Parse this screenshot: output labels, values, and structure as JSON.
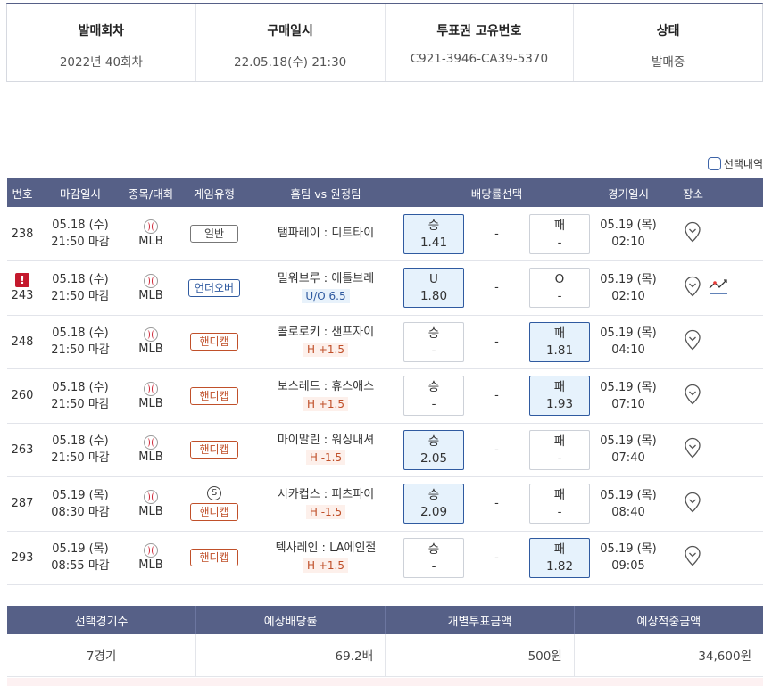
{
  "summary": {
    "round_label": "발매회차",
    "round_value": "2022년 40회차",
    "purchase_label": "구매일시",
    "purchase_value": "22.05.18(수) 21:30",
    "ticket_label": "투표권 고유번호",
    "ticket_value": "C921-3946-CA39-5370",
    "status_label": "상태",
    "status_value": "발매중"
  },
  "selection_history": "선택내역",
  "columns": [
    "번호",
    "마감일시",
    "종목/대회",
    "게임유형",
    "홈팀 vs 원정팀",
    "배당률선택",
    "경기일시",
    "장소"
  ],
  "rows": [
    {
      "no": "238",
      "dl_date": "05.18 (수)",
      "dl_time": "21:50 마감",
      "league": "MLB",
      "type": "일반",
      "type_kind": "normal",
      "s_badge": "",
      "home": "탬파레이",
      "away": "디트타이",
      "sub": "",
      "sub_kind": "",
      "left_label": "승",
      "left_odd": "1.41",
      "left_sel": true,
      "mid": "-",
      "right_label": "패",
      "right_odd": "-",
      "right_sel": false,
      "g_date": "05.19 (목)",
      "g_time": "02:10",
      "warn": false,
      "trend": false
    },
    {
      "no": "243",
      "dl_date": "05.18 (수)",
      "dl_time": "21:50 마감",
      "league": "MLB",
      "type": "언더오버",
      "type_kind": "uo",
      "s_badge": "",
      "home": "밀워브루",
      "away": "애틀브레",
      "sub": "U/O 6.5",
      "sub_kind": "uo",
      "left_label": "U",
      "left_odd": "1.80",
      "left_sel": true,
      "mid": "-",
      "right_label": "O",
      "right_odd": "-",
      "right_sel": false,
      "g_date": "05.19 (목)",
      "g_time": "02:10",
      "warn": true,
      "trend": true
    },
    {
      "no": "248",
      "dl_date": "05.18 (수)",
      "dl_time": "21:50 마감",
      "league": "MLB",
      "type": "핸디캡",
      "type_kind": "hc",
      "s_badge": "",
      "home": "콜로로키",
      "away": "샌프자이",
      "sub": "H +1.5",
      "sub_kind": "hc",
      "left_label": "승",
      "left_odd": "-",
      "left_sel": false,
      "mid": "-",
      "right_label": "패",
      "right_odd": "1.81",
      "right_sel": true,
      "g_date": "05.19 (목)",
      "g_time": "04:10",
      "warn": false,
      "trend": false
    },
    {
      "no": "260",
      "dl_date": "05.18 (수)",
      "dl_time": "21:50 마감",
      "league": "MLB",
      "type": "핸디캡",
      "type_kind": "hc",
      "s_badge": "",
      "home": "보스레드",
      "away": "휴스애스",
      "sub": "H +1.5",
      "sub_kind": "hc",
      "left_label": "승",
      "left_odd": "-",
      "left_sel": false,
      "mid": "-",
      "right_label": "패",
      "right_odd": "1.93",
      "right_sel": true,
      "g_date": "05.19 (목)",
      "g_time": "07:10",
      "warn": false,
      "trend": false
    },
    {
      "no": "263",
      "dl_date": "05.18 (수)",
      "dl_time": "21:50 마감",
      "league": "MLB",
      "type": "핸디캡",
      "type_kind": "hc",
      "s_badge": "",
      "home": "마이말린",
      "away": "워싱내셔",
      "sub": "H -1.5",
      "sub_kind": "hc",
      "left_label": "승",
      "left_odd": "2.05",
      "left_sel": true,
      "mid": "-",
      "right_label": "패",
      "right_odd": "-",
      "right_sel": false,
      "g_date": "05.19 (목)",
      "g_time": "07:40",
      "warn": false,
      "trend": false
    },
    {
      "no": "287",
      "dl_date": "05.19 (목)",
      "dl_time": "08:30 마감",
      "league": "MLB",
      "type": "핸디캡",
      "type_kind": "hc",
      "s_badge": "S",
      "home": "시카컵스",
      "away": "피츠파이",
      "sub": "H -1.5",
      "sub_kind": "hc",
      "left_label": "승",
      "left_odd": "2.09",
      "left_sel": true,
      "mid": "-",
      "right_label": "패",
      "right_odd": "-",
      "right_sel": false,
      "g_date": "05.19 (목)",
      "g_time": "08:40",
      "warn": false,
      "trend": false
    },
    {
      "no": "293",
      "dl_date": "05.19 (목)",
      "dl_time": "08:55 마감",
      "league": "MLB",
      "type": "핸디캡",
      "type_kind": "hc",
      "s_badge": "",
      "home": "텍사레인",
      "away": "LA에인절",
      "sub": "H +1.5",
      "sub_kind": "hc",
      "left_label": "승",
      "left_odd": "-",
      "left_sel": false,
      "mid": "-",
      "right_label": "패",
      "right_odd": "1.82",
      "right_sel": true,
      "g_date": "05.19 (목)",
      "g_time": "09:05",
      "warn": false,
      "trend": false
    }
  ],
  "totals": {
    "headers": [
      "선택경기수",
      "예상배당률",
      "개별투표금액",
      "예상적중금액"
    ],
    "values": [
      "7경기",
      "69.2배",
      "500원",
      "34,600원"
    ]
  },
  "colors": {
    "header_bg": "#566087",
    "selected_bg": "#e6f2fc",
    "handicap": "#c0502a",
    "underover": "#2f5aa0",
    "warning": "#c4192d"
  }
}
